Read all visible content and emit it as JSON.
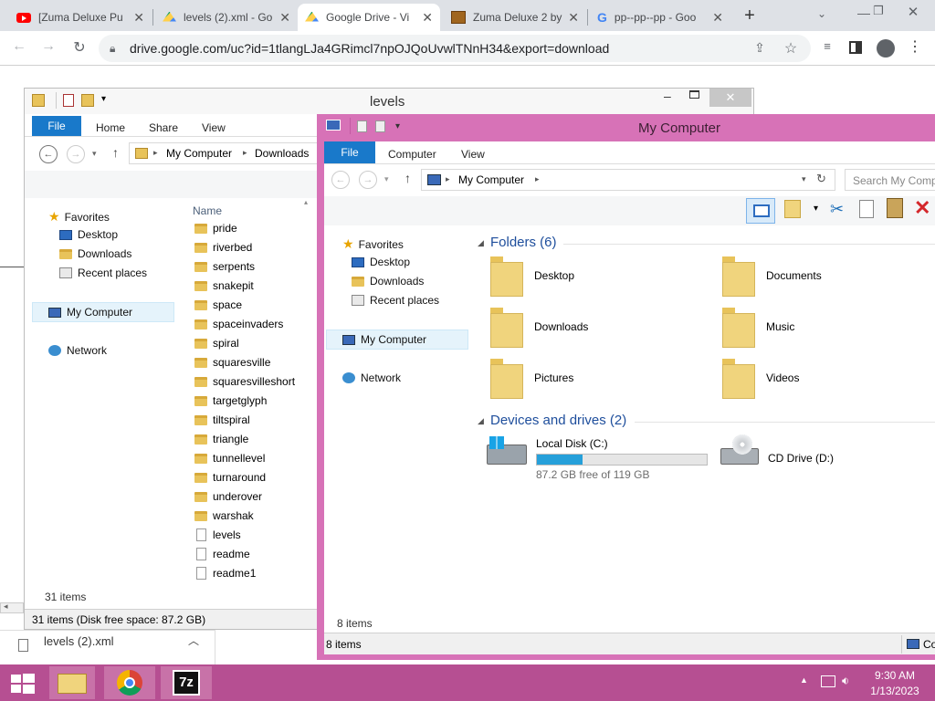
{
  "browser": {
    "tabs": [
      {
        "title": "[Zuma Deluxe Pu"
      },
      {
        "title": "levels (2).xml - Go"
      },
      {
        "title": "Google Drive - Vi"
      },
      {
        "title": "Zuma Deluxe 2 by"
      },
      {
        "title": "pp--pp--pp - Goo"
      }
    ],
    "url": "drive.google.com/uc?id=1tlangLJa4GRimcl7npOJQoUvwlTNnH34&export=download",
    "new_tab": "+"
  },
  "levels_window": {
    "title": "levels",
    "ribbon": {
      "file": "File",
      "home": "Home",
      "share": "Share",
      "view": "View"
    },
    "path": [
      "My Computer",
      "Downloads"
    ],
    "column": "Name",
    "nav": {
      "favorites": "Favorites",
      "desktop": "Desktop",
      "downloads": "Downloads",
      "recent": "Recent places",
      "computer": "My Computer",
      "network": "Network"
    },
    "files": [
      "pride",
      "riverbed",
      "serpents",
      "snakepit",
      "space",
      "spaceinvaders",
      "spiral",
      "squaresville",
      "squaresvilleshort",
      "targetglyph",
      "tiltspiral",
      "triangle",
      "tunnellevel",
      "turnaround",
      "underover",
      "warshak",
      "levels",
      "readme",
      "readme1"
    ],
    "count": "31 items",
    "status": "31 items (Disk free space: 87.2 GB)"
  },
  "computer_window": {
    "title": "My Computer",
    "ribbon": {
      "file": "File",
      "computer": "Computer",
      "view": "View"
    },
    "path": "My Computer",
    "search_placeholder": "Search My Comp",
    "nav": {
      "favorites": "Favorites",
      "desktop": "Desktop",
      "downloads": "Downloads",
      "recent": "Recent places",
      "computer": "My Computer",
      "network": "Network"
    },
    "folders_header": "Folders (6)",
    "folders": [
      "Desktop",
      "Documents",
      "Downloads",
      "Music",
      "Pictures",
      "Videos"
    ],
    "devices_header": "Devices and drives (2)",
    "local_disk": {
      "name": "Local Disk (C:)",
      "free": "87.2 GB free of 119 GB",
      "used_fraction": 0.27
    },
    "cd_drive": "CD Drive (D:)",
    "count": "8 items",
    "status": "8 items",
    "status_right": "Co"
  },
  "download": {
    "file": "levels (2).xml"
  },
  "taskbar": {
    "time": "9:30 AM",
    "date": "1/13/2023",
    "sevenzip": "7z"
  }
}
